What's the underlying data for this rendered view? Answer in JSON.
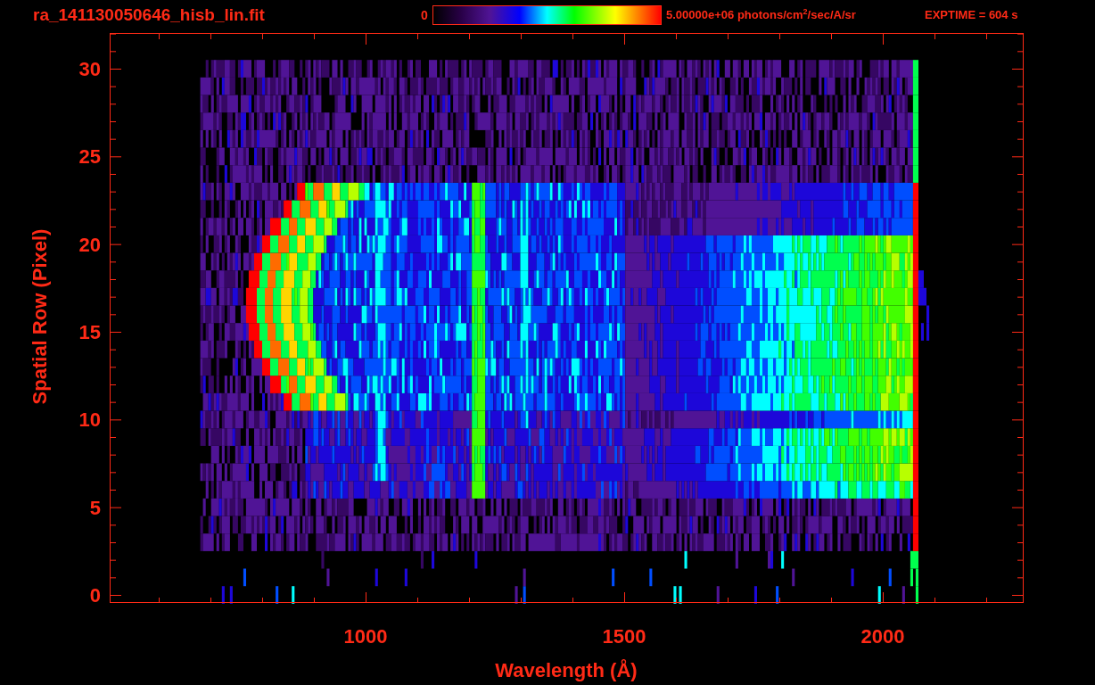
{
  "header": {
    "title": "ra_141130050646_hisb_lin.fit",
    "colorbar_min": "0",
    "colorbar_max": "5.00000e+06 photons/cm$^{2}$/sec/A/sr",
    "exposure": "EXPTIME = 604 s"
  },
  "plot": {
    "xlabel": "Wavelength (Å)",
    "ylabel": "Spatial Row (Pixel)",
    "xticks": [
      "1000",
      "1500",
      "2000"
    ],
    "yticks": [
      "30",
      "25",
      "20",
      "15",
      "10",
      "5",
      "0"
    ]
  }
}
